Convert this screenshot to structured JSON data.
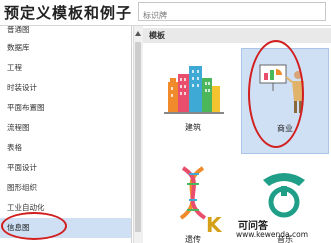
{
  "dialog": {
    "title": "预定义模板和例子",
    "search_placeholder": "标识牌"
  },
  "sidebar": {
    "items": [
      {
        "label": "普通图",
        "selected": false
      },
      {
        "label": "数据库",
        "selected": false
      },
      {
        "label": "工程",
        "selected": false
      },
      {
        "label": "时装设计",
        "selected": false
      },
      {
        "label": "平面布置图",
        "selected": false
      },
      {
        "label": "流程图",
        "selected": false
      },
      {
        "label": "表格",
        "selected": false
      },
      {
        "label": "平面设计",
        "selected": false
      },
      {
        "label": "图形组织",
        "selected": false
      },
      {
        "label": "工业自动化",
        "selected": false
      },
      {
        "label": "信息图",
        "selected": true
      }
    ]
  },
  "gallery": {
    "section_title": "模板",
    "tiles": [
      {
        "label": "建筑",
        "icon": "city-buildings-icon",
        "selected": false
      },
      {
        "label": "商业",
        "icon": "business-presentation-icon",
        "selected": true
      },
      {
        "label": "遗传",
        "icon": "dna-helix-icon",
        "selected": false
      },
      {
        "label": "音乐",
        "icon": "french-horn-icon",
        "selected": false
      }
    ]
  },
  "watermark": {
    "brand_letter": "K",
    "text": "可问答",
    "url": "www.kewenda.com"
  },
  "colors": {
    "selection": "#cfe0f4",
    "annotation": "#d21f1f",
    "section_bar": "#e9e9e9",
    "watermark_gold": "#d4a017"
  }
}
